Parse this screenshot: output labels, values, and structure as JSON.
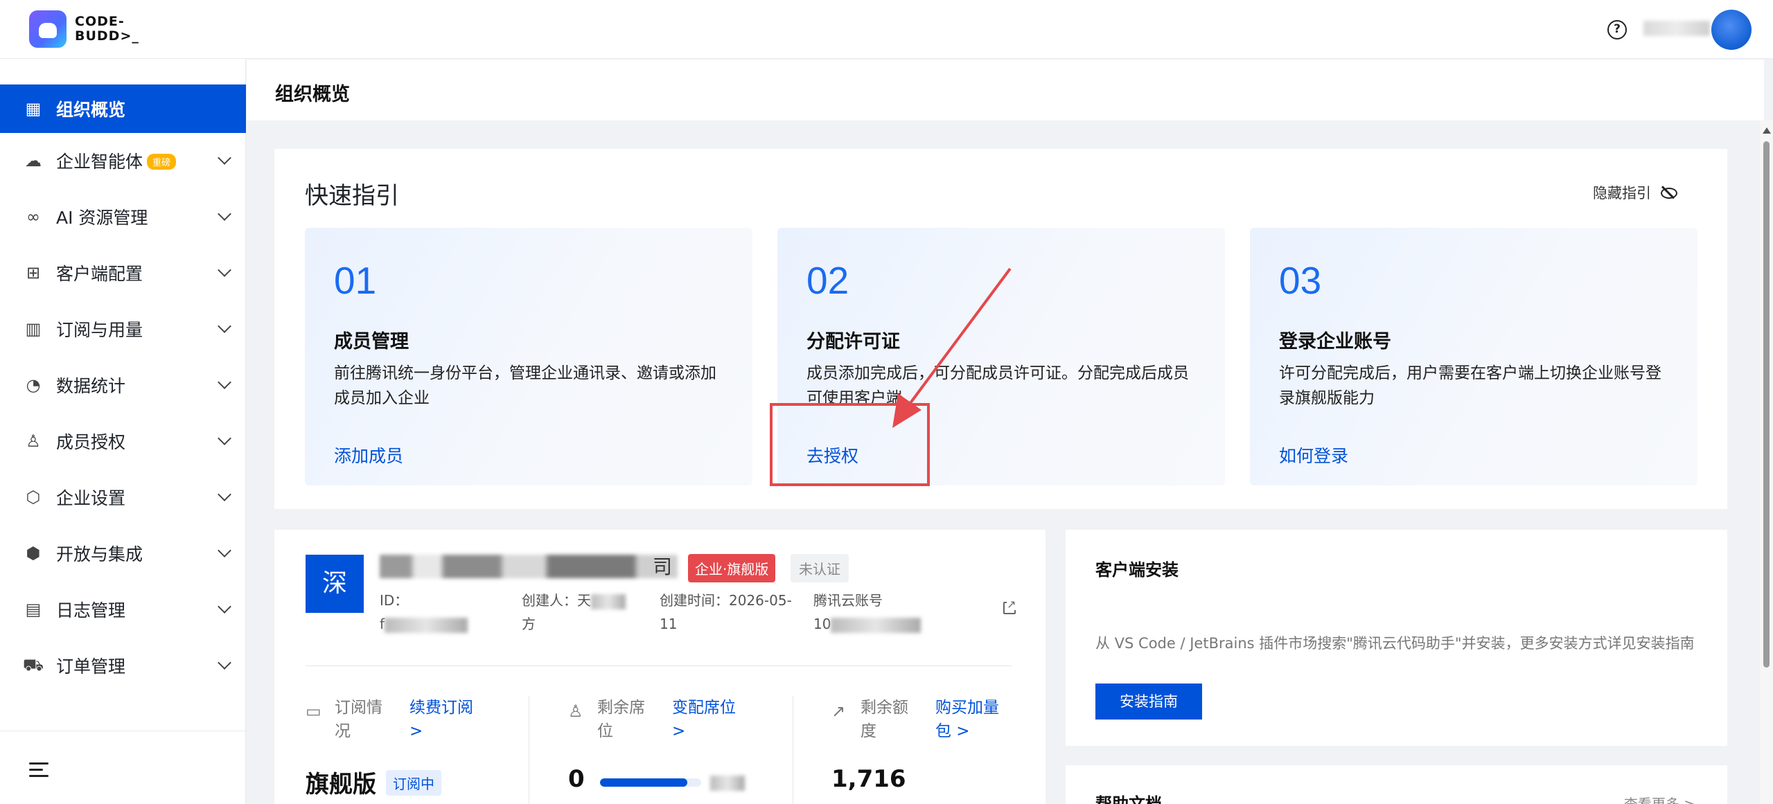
{
  "app": {
    "logo_text_line1": "CODE-",
    "logo_text_line2": "BUDD>_"
  },
  "header": {
    "help_icon": "?"
  },
  "sidebar": {
    "items": [
      {
        "label": "组织概览",
        "icon": "dashboard-icon",
        "glyph": "▦"
      },
      {
        "label": "企业智能体",
        "icon": "cloud-icon",
        "glyph": "☁",
        "badge": "重磅"
      },
      {
        "label": "AI 资源管理",
        "icon": "infinity-icon",
        "glyph": "∞"
      },
      {
        "label": "客户端配置",
        "icon": "grid-icon",
        "glyph": "⊞"
      },
      {
        "label": "订阅与用量",
        "icon": "bar-chart-icon",
        "glyph": "▥"
      },
      {
        "label": "数据统计",
        "icon": "pie-chart-icon",
        "glyph": "◔"
      },
      {
        "label": "成员授权",
        "icon": "user-icon",
        "glyph": "♙"
      },
      {
        "label": "企业设置",
        "icon": "settings-icon",
        "glyph": "⬡"
      },
      {
        "label": "开放与集成",
        "icon": "cube-icon",
        "glyph": "⬢"
      },
      {
        "label": "日志管理",
        "icon": "calendar-icon",
        "glyph": "▤"
      },
      {
        "label": "订单管理",
        "icon": "cart-icon",
        "glyph": "⛟"
      }
    ]
  },
  "page": {
    "title": "组织概览"
  },
  "guide": {
    "title": "快速指引",
    "hide_label": "隐藏指引",
    "steps": [
      {
        "num": "01",
        "title": "成员管理",
        "desc": "前往腾讯统一身份平台，管理企业通讯录、邀请或添加成员加入企业",
        "link": "添加成员"
      },
      {
        "num": "02",
        "title": "分配许可证",
        "desc": "成员添加完成后，可分配成员许可证。分配完成后成员可使用客户端",
        "link": "去授权"
      },
      {
        "num": "03",
        "title": "登录企业账号",
        "desc": "许可分配完成后，用户需要在客户端上切换企业账号登录旗舰版能力",
        "link": "如何登录"
      }
    ]
  },
  "org": {
    "avatar_char": "深",
    "name_suffix": "司",
    "tag_plan": "企业·旗舰版",
    "tag_verify": "未认证",
    "id_label": "ID：",
    "id_value_prefix": "f",
    "creator_label": "创建人：天",
    "creator_line2": "方",
    "created_label": "创建时间：2026-05-",
    "created_line2": "11",
    "cloud_label": "腾讯云账号",
    "cloud_value_prefix": "10",
    "stats": {
      "subscription_label": "订阅情况",
      "subscription_link": "续费订阅 >",
      "subscription_value": "旗舰版",
      "subscription_badge": "订阅中",
      "seats_label": "剩余席位",
      "seats_link": "变配席位 >",
      "seats_value": "0",
      "seats_fill": 0.86,
      "quota_label": "剩余额度",
      "quota_link": "购买加量包 >",
      "quota_value": "1,716"
    }
  },
  "install": {
    "title": "客户端安装",
    "desc": "从 VS Code / JetBrains 插件市场搜索\"腾讯云代码助手\"并安装，更多安装方式详见安装指南",
    "button": "安装指南"
  },
  "help": {
    "title": "帮助文档",
    "more": "查看更多 >"
  },
  "colors": {
    "primary": "#0052d9",
    "danger": "#e5484d",
    "accent_number": "#1a6bf0"
  }
}
